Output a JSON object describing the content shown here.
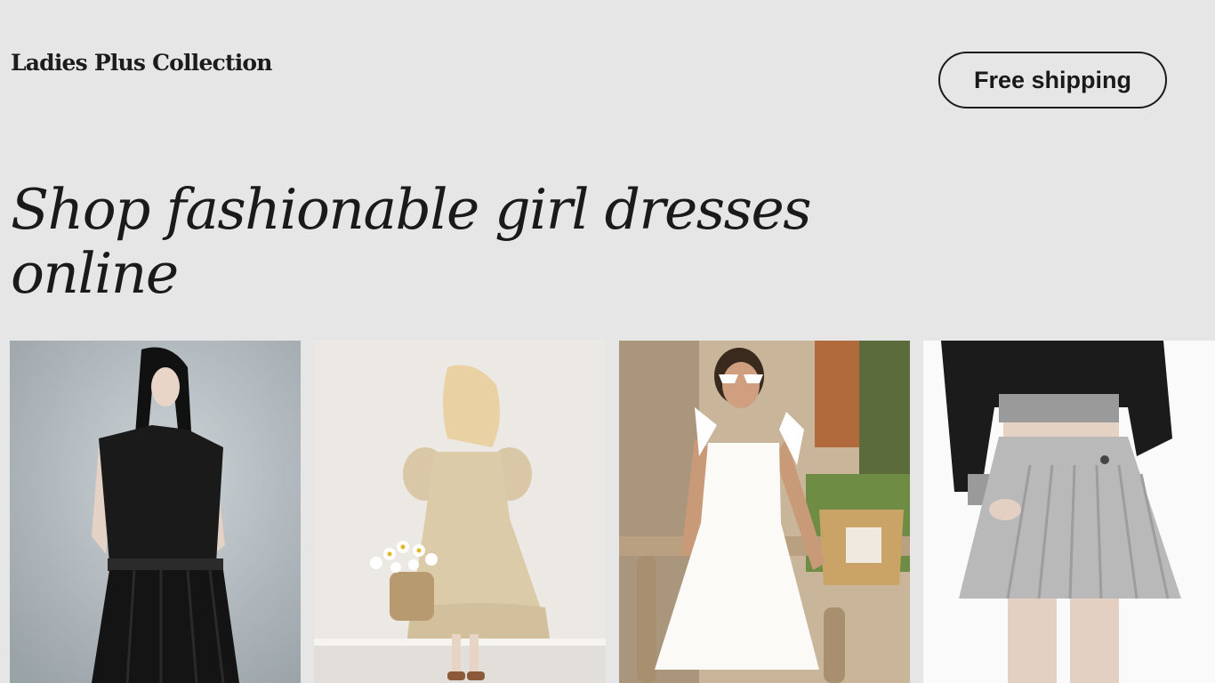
{
  "header": {
    "brand": "Ladies Plus Collection",
    "cta_label": "Free shipping"
  },
  "hero": {
    "headline": "Shop fashionable girl dresses online"
  },
  "gallery": {
    "items": [
      {
        "description_icon": "black-belted-dress-photo"
      },
      {
        "description_icon": "beige-puff-sleeve-dress-photo"
      },
      {
        "description_icon": "white-tie-strap-dress-photo"
      },
      {
        "description_icon": "grey-pleated-skirt-photo"
      }
    ]
  }
}
